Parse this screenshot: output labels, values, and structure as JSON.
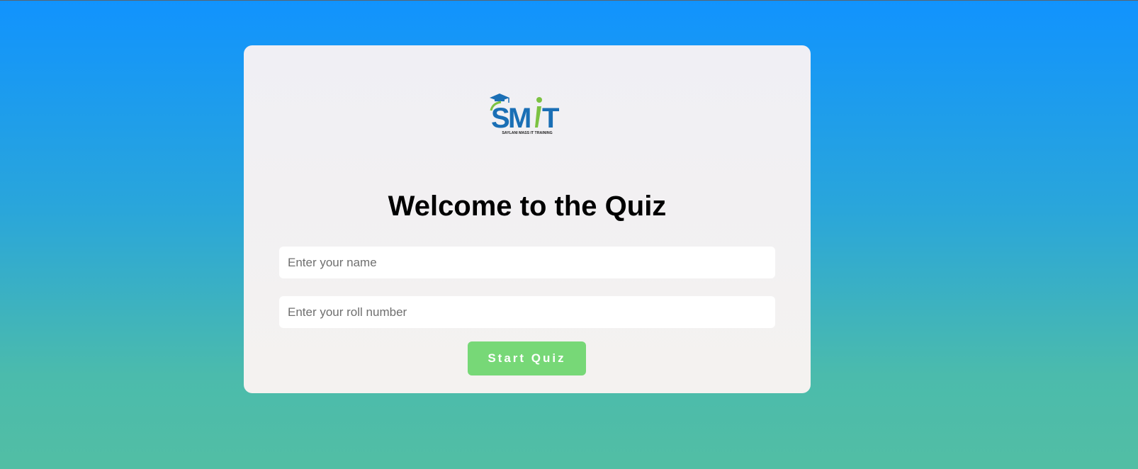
{
  "logo": {
    "wordmark": "SMIT",
    "tagline": "SAYLANI MASS IT TRAINING",
    "icon": "graduation-cap-icon"
  },
  "heading": "Welcome to the Quiz",
  "form": {
    "name_placeholder": "Enter your name",
    "name_value": "",
    "roll_placeholder": "Enter your roll number",
    "roll_value": "",
    "start_label": "Start Quiz"
  },
  "colors": {
    "background_top": "#1193fe",
    "background_bottom": "#52bea4",
    "card": "#f2f1f2",
    "button": "#77d877",
    "logo_blue": "#1a6fb5",
    "logo_green": "#7cc242"
  }
}
